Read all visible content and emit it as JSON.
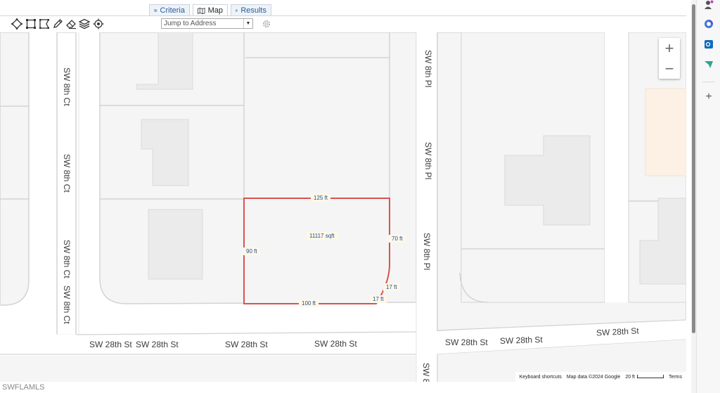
{
  "tabs": {
    "criteria": "Criteria",
    "map": "Map",
    "results": "Results"
  },
  "toolbar": {
    "tools": [
      "polygon-icon",
      "rectangle-icon",
      "lasso-icon",
      "pencil-icon",
      "eraser-icon",
      "layers-icon",
      "locate-icon"
    ],
    "jump_placeholder": "Jump to Address",
    "settings_icon": "gear-icon"
  },
  "map": {
    "streets": {
      "sw8thct": "SW 8th Ct",
      "sw8thpl": "SW 8th Pl",
      "sw28thst": "SW 28th St",
      "sw8_cut": "SW 8"
    },
    "parcel": {
      "top": "125 ft",
      "area": "11117 sqft",
      "right": "70 ft",
      "left": "90 ft",
      "corner_a": "17 ft",
      "corner_b": "17 ft",
      "bottom": "100 ft"
    },
    "zoom": {
      "in": "+",
      "out": "−"
    },
    "attribution": {
      "shortcuts": "Keyboard shortcuts",
      "data": "Map data ©2024 Google",
      "scale": "20 ft",
      "terms": "Terms"
    },
    "colors": {
      "parcel_border": "#d9534f",
      "building": "#ebebeb",
      "road": "#ffffff",
      "block": "#f5f5f5"
    }
  },
  "footer": {
    "watermark": "SWFLAMLS"
  },
  "edge_sidebar": {
    "icons": [
      "profile-icon",
      "copilot-icon",
      "outlook-icon",
      "send-icon"
    ],
    "add": "+"
  }
}
